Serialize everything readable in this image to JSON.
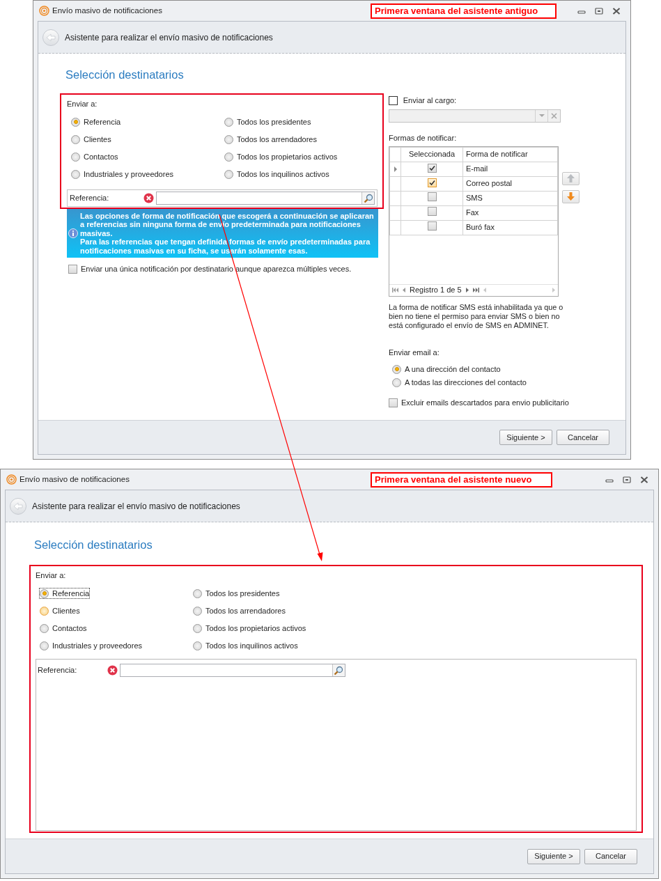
{
  "windows": [
    {
      "title": "Envío masivo de notificaciones",
      "callout": "Primera ventana del asistente antiguo",
      "wizard_header": "Asistente para realizar el envío masivo de notificaciones",
      "heading": "Selección destinatarios",
      "send_to": {
        "label": "Enviar a:",
        "options": [
          {
            "label": "Referencia",
            "selected": true,
            "hovered": false,
            "focused": false
          },
          {
            "label": "Todos los presidentes",
            "selected": false,
            "hovered": false,
            "focused": false
          },
          {
            "label": "Clientes",
            "selected": false,
            "hovered": false,
            "focused": false
          },
          {
            "label": "Todos los arrendadores",
            "selected": false,
            "hovered": false,
            "focused": false
          },
          {
            "label": "Contactos",
            "selected": false,
            "hovered": false,
            "focused": false
          },
          {
            "label": "Todos los propietarios activos",
            "selected": false,
            "hovered": false,
            "focused": false
          },
          {
            "label": "Industriales y proveedores",
            "selected": false,
            "hovered": false,
            "focused": false
          },
          {
            "label": "Todos los inquilinos activos",
            "selected": false,
            "hovered": false,
            "focused": false
          }
        ]
      },
      "reference": {
        "label": "Referencia:"
      },
      "info": [
        "Las opciones de forma de notificación que escogerá a continuación se aplicaran a referencias sin ninguna forma de envío predeterminada para notificaciones masivas.",
        "Para las referencias que tengan definida formas de envío predeterminadas para notificaciones masivas en su ficha, se usarán solamente esas."
      ],
      "single_notification": {
        "label": "Enviar una única notificación por destinatario aunque aparezca múltiples veces.",
        "checked": false
      },
      "right_panel": {
        "send_to_role": {
          "label": "Enviar al cargo:",
          "checked": false
        },
        "methods_label": "Formas de notificar:",
        "grid": {
          "columns": [
            "Seleccionada",
            "Forma de notificar"
          ],
          "rows": [
            {
              "name": "E-mail",
              "checked": true,
              "current": true,
              "hovered": false
            },
            {
              "name": "Correo postal",
              "checked": true,
              "current": false,
              "hovered": true
            },
            {
              "name": "SMS",
              "checked": false,
              "current": false,
              "hovered": false
            },
            {
              "name": "Fax",
              "checked": false,
              "current": false,
              "hovered": false
            },
            {
              "name": "Buró fax",
              "checked": false,
              "current": false,
              "hovered": false
            }
          ],
          "navigator": "Registro 1 de 5"
        },
        "note": "La forma de notificar SMS está inhabilitada ya que o bien no tiene el permiso para enviar SMS o bien no está configurado el envío de SMS en ADMINET.",
        "email_label": "Enviar email a:",
        "email_options": [
          {
            "label": "A una dirección del contacto",
            "selected": true
          },
          {
            "label": "A todas las direcciones del contacto",
            "selected": false
          }
        ],
        "exclude": {
          "label": "Excluir emails descartados para envio publicitario",
          "checked": false
        }
      },
      "buttons": [
        "Siguiente >",
        "Cancelar"
      ]
    },
    {
      "title": "Envío masivo de notificaciones",
      "callout": "Primera ventana del asistente nuevo",
      "wizard_header": "Asistente para realizar el envío masivo de notificaciones",
      "heading": "Selección destinatarios",
      "send_to": {
        "label": "Enviar a:",
        "options": [
          {
            "label": "Referencia",
            "selected": true,
            "hovered": false,
            "focused": true
          },
          {
            "label": "Todos los presidentes",
            "selected": false,
            "hovered": false,
            "focused": false
          },
          {
            "label": "Clientes",
            "selected": false,
            "hovered": true,
            "focused": false
          },
          {
            "label": "Todos los arrendadores",
            "selected": false,
            "hovered": false,
            "focused": false
          },
          {
            "label": "Contactos",
            "selected": false,
            "hovered": false,
            "focused": false
          },
          {
            "label": "Todos los propietarios activos",
            "selected": false,
            "hovered": false,
            "focused": false
          },
          {
            "label": "Industriales y proveedores",
            "selected": false,
            "hovered": false,
            "focused": false
          },
          {
            "label": "Todos los inquilinos activos",
            "selected": false,
            "hovered": false,
            "focused": false
          }
        ]
      },
      "reference": {
        "label": "Referencia:"
      },
      "buttons": [
        "Siguiente >",
        "Cancelar"
      ]
    }
  ]
}
